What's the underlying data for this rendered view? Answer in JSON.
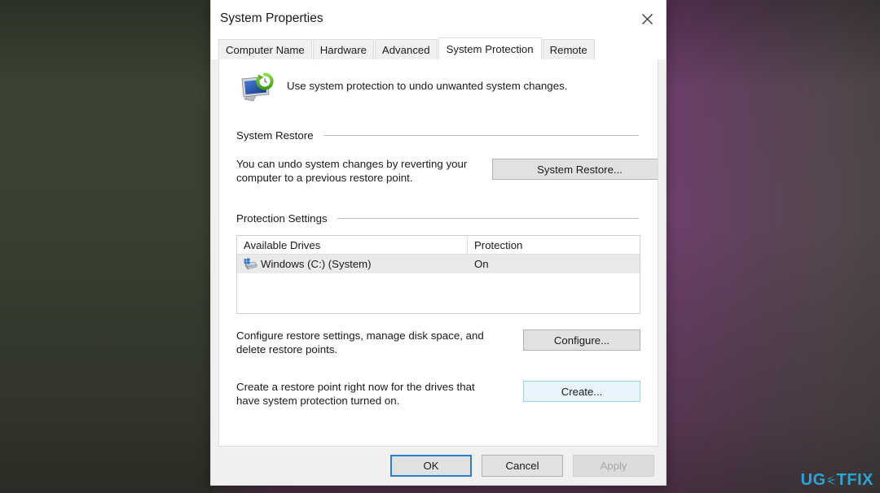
{
  "watermark": {
    "text_a": "UG",
    "text_b": "TFIX",
    "mark_icon": "ugetfix-lightning-e-icon",
    "color": "#25a8d6"
  },
  "dialog": {
    "title": "System Properties",
    "close_icon": "close-icon",
    "tabs": [
      {
        "label": "Computer Name",
        "active": false
      },
      {
        "label": "Hardware",
        "active": false
      },
      {
        "label": "Advanced",
        "active": false
      },
      {
        "label": "System Protection",
        "active": true
      },
      {
        "label": "Remote",
        "active": false
      }
    ],
    "panel": {
      "header_icon": "system-protection-monitor-restore-icon",
      "header_text": "Use system protection to undo unwanted system changes.",
      "system_restore": {
        "heading": "System Restore",
        "description": "You can undo system changes by reverting your computer to a previous restore point.",
        "button_label": "System Restore..."
      },
      "protection_settings": {
        "heading": "Protection Settings",
        "table": {
          "columns": [
            "Available Drives",
            "Protection"
          ],
          "rows": [
            {
              "drive_icon": "hard-drive-windows-icon",
              "drive": "Windows (C:) (System)",
              "protection": "On",
              "selected": true
            }
          ]
        },
        "configure": {
          "description": "Configure restore settings, manage disk space, and delete restore points.",
          "button_label": "Configure..."
        },
        "create": {
          "description": "Create a restore point right now for the drives that have system protection turned on.",
          "button_label": "Create...",
          "button_state": "highlighted"
        }
      }
    },
    "footer": {
      "ok_label": "OK",
      "cancel_label": "Cancel",
      "apply_label": "Apply",
      "ok_state": "focused",
      "apply_state": "disabled"
    }
  },
  "colors": {
    "accent_focus": "#2b7cd3",
    "highlight_button": "#e8f4fb",
    "dialog_bg": "#f0f0f0",
    "panel_bg": "#ffffff",
    "watermark": "#25a8d6"
  }
}
